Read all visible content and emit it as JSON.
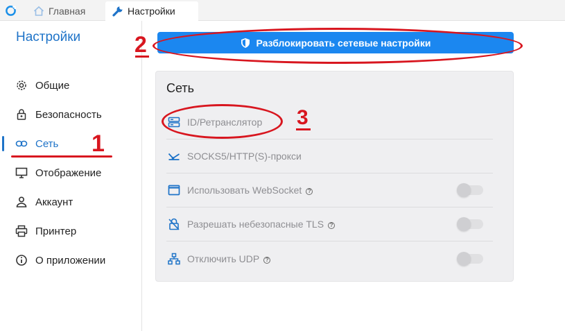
{
  "tabs": [
    {
      "label": "Главная",
      "icon": "home-icon"
    },
    {
      "label": "Настройки",
      "icon": "wrench-icon"
    }
  ],
  "sidebar": {
    "title": "Настройки",
    "items": [
      {
        "label": "Общие",
        "icon": "gear-icon"
      },
      {
        "label": "Безопасность",
        "icon": "lock-icon"
      },
      {
        "label": "Сеть",
        "icon": "link-icon",
        "active": true
      },
      {
        "label": "Отображение",
        "icon": "monitor-icon"
      },
      {
        "label": "Аккаунт",
        "icon": "person-icon"
      },
      {
        "label": "Принтер",
        "icon": "printer-icon"
      },
      {
        "label": "О приложении",
        "icon": "info-icon"
      }
    ]
  },
  "main": {
    "unlock_button": {
      "label": "Разблокировать сетевые настройки",
      "icon": "shield-icon"
    },
    "panel": {
      "title": "Сеть",
      "rows": [
        {
          "label": "ID/Ретранслятор",
          "icon": "server-icon"
        },
        {
          "label": "SOCKS5/HTTP(S)-прокси",
          "icon": "proxy-icon"
        },
        {
          "label": "Использовать WebSocket",
          "icon": "window-icon",
          "help": "?",
          "toggle": false
        },
        {
          "label": "Разрешать небезопасные TLS",
          "icon": "unlock-icon",
          "help": "?",
          "toggle": false
        },
        {
          "label": "Отключить UDP",
          "icon": "network-icon",
          "help": "?",
          "toggle": false
        }
      ]
    }
  },
  "annotations": {
    "one": "1",
    "two": "2",
    "three": "3"
  },
  "colors": {
    "accent": "#1e73c8",
    "button": "#1b87f0",
    "annotation": "#d8161f",
    "panel": "#efeff1"
  }
}
